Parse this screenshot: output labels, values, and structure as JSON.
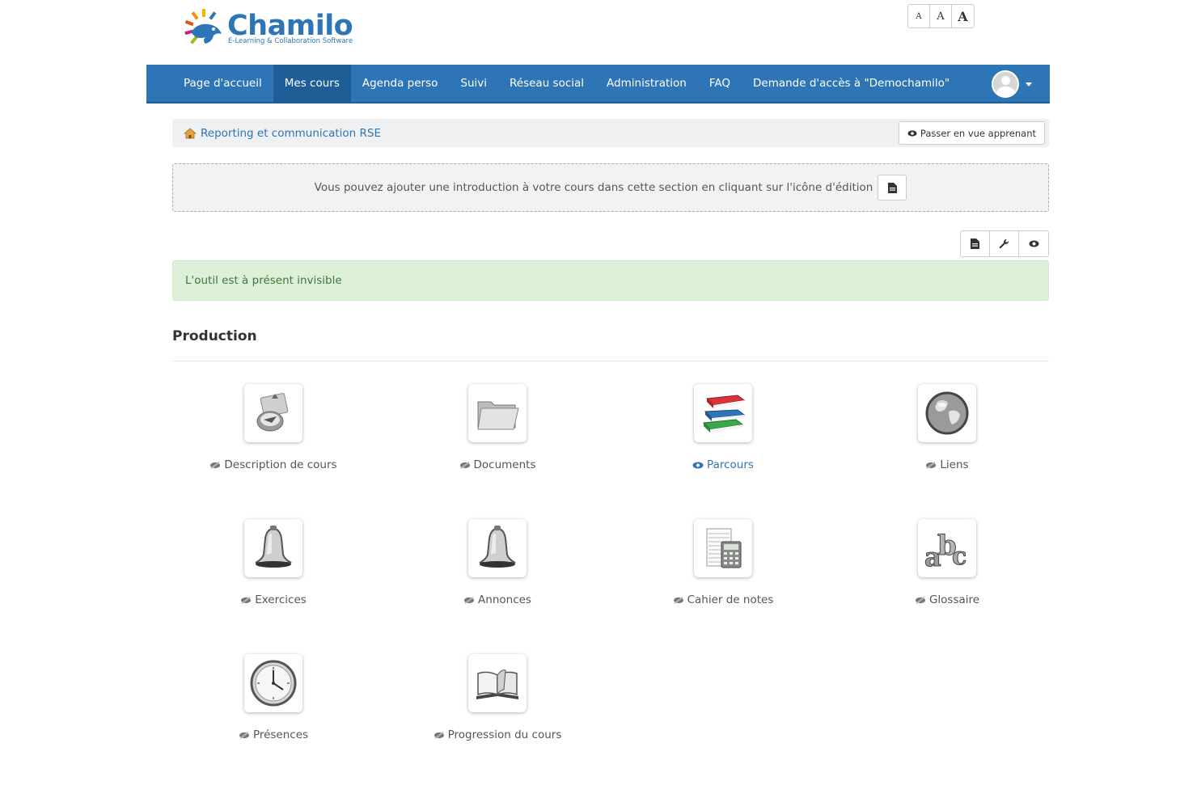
{
  "brand": {
    "name": "Chamilo",
    "tagline": "E-Learning & Collaboration Software"
  },
  "font_sizer": [
    "A",
    "A",
    "A"
  ],
  "nav": {
    "items": [
      {
        "label": "Page d'accueil",
        "active": false
      },
      {
        "label": "Mes cours",
        "active": true
      },
      {
        "label": "Agenda perso",
        "active": false
      },
      {
        "label": "Suivi",
        "active": false
      },
      {
        "label": "Réseau social",
        "active": false
      },
      {
        "label": "Administration",
        "active": false
      },
      {
        "label": "FAQ",
        "active": false
      },
      {
        "label": "Demande d'accès à \"Demochamilo\"",
        "active": false
      }
    ]
  },
  "breadcrumb": {
    "course": "Reporting et communication RSE",
    "student_view": "Passer en vue apprenant"
  },
  "intro": {
    "text": "Vous pouvez ajouter une introduction à votre cours dans cette section en cliquant sur l'icône d'édition"
  },
  "alert": {
    "message": "L'outil est à présent invisible"
  },
  "section": {
    "title": "Production"
  },
  "tools": [
    {
      "label": "Description de cours",
      "icon": "course-description-icon",
      "visible": false
    },
    {
      "label": "Documents",
      "icon": "folder-icon",
      "visible": false
    },
    {
      "label": "Parcours",
      "icon": "books-icon",
      "visible": true
    },
    {
      "label": "Liens",
      "icon": "globe-icon",
      "visible": false
    },
    {
      "label": "Exercices",
      "icon": "bell-icon",
      "visible": false
    },
    {
      "label": "Annonces",
      "icon": "bell-icon",
      "visible": false
    },
    {
      "label": "Cahier de notes",
      "icon": "calculator-icon",
      "visible": false
    },
    {
      "label": "Glossaire",
      "icon": "abc-icon",
      "visible": false
    },
    {
      "label": "Présences",
      "icon": "clock-icon",
      "visible": false
    },
    {
      "label": "Progression du cours",
      "icon": "book-icon",
      "visible": false
    }
  ],
  "colors": {
    "primary": "#2e75b6",
    "primary_dark": "#1f5d96",
    "success_bg": "#dff0d8",
    "success_text": "#3c763d"
  }
}
